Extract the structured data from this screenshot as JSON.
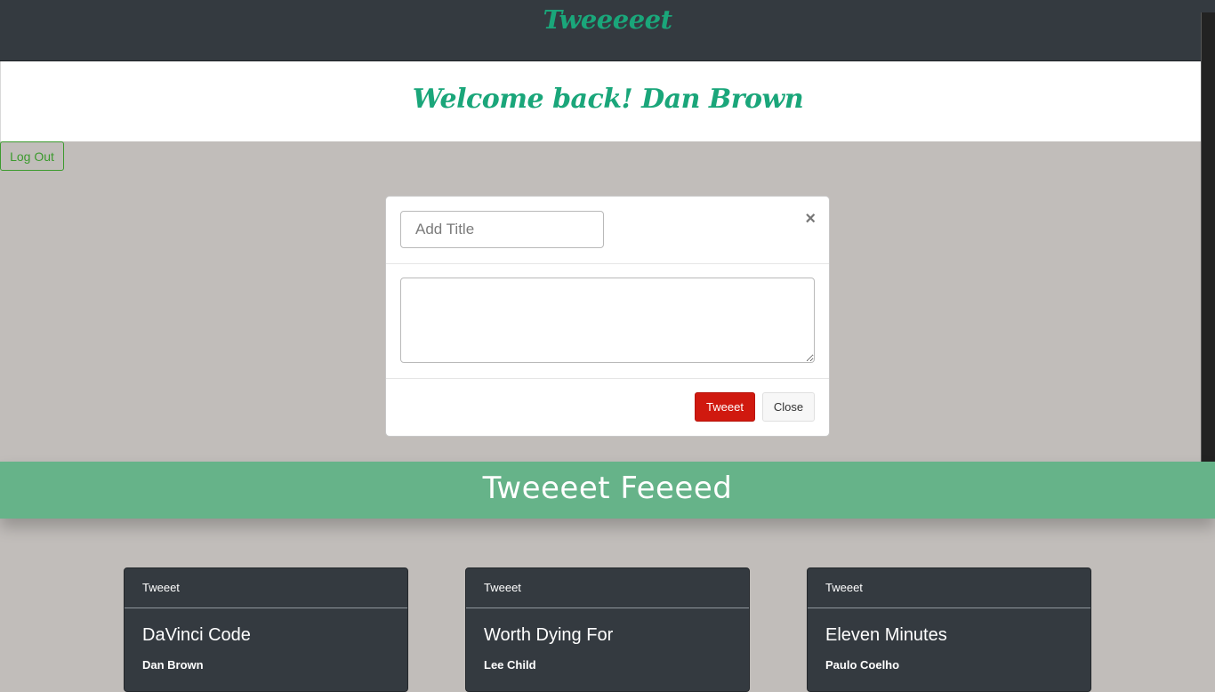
{
  "header": {
    "brand": "Tweeeeet"
  },
  "welcome": {
    "text": "Welcome back! Dan Brown"
  },
  "actions": {
    "logout_label": "Log Out"
  },
  "modal": {
    "title_placeholder": "Add Title",
    "title_value": "",
    "body_value": "",
    "close_symbol": "×",
    "tweet_label": "Tweeet",
    "close_label": "Close"
  },
  "feed": {
    "title": "Tweeeet Feeeed",
    "cards": [
      {
        "header": "Tweeet",
        "title": "DaVinci Code",
        "author": "Dan Brown"
      },
      {
        "header": "Tweeet",
        "title": "Worth Dying For",
        "author": "Lee Child"
      },
      {
        "header": "Tweeet",
        "title": "Eleven Minutes",
        "author": "Paulo Coelho"
      }
    ]
  },
  "colors": {
    "brand_green": "#1aa67a",
    "navbar_bg": "#343a40",
    "page_bg": "#c1bdba",
    "feed_banner": "#66b389",
    "tweet_button": "#d0190f",
    "logout_outline": "#3c9a2e"
  }
}
